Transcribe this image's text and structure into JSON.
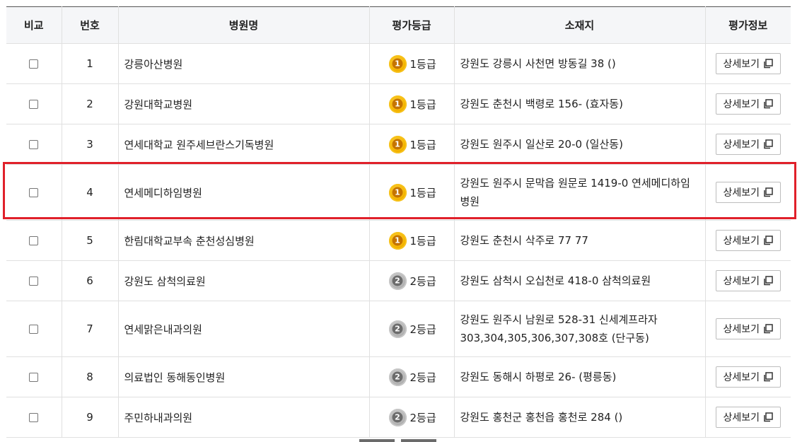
{
  "columns": {
    "compare": "비교",
    "number": "번호",
    "hospital": "병원명",
    "grade": "평가등급",
    "address": "소재지",
    "info": "평가정보"
  },
  "detail_label": "상세보기",
  "rows": [
    {
      "no": "1",
      "name": "강릉아산병원",
      "grade_num": "1",
      "grade": "1등급",
      "address": "강원도 강릉시 사천면 방동길 38 ()"
    },
    {
      "no": "2",
      "name": "강원대학교병원",
      "grade_num": "1",
      "grade": "1등급",
      "address": "강원도 춘천시 백령로 156- (효자동)"
    },
    {
      "no": "3",
      "name": "연세대학교 원주세브란스기독병원",
      "grade_num": "1",
      "grade": "1등급",
      "address": "강원도 원주시 일산로 20-0 (일산동)"
    },
    {
      "no": "4",
      "name": "연세메디하임병원",
      "grade_num": "1",
      "grade": "1등급",
      "address": "강원도 원주시 문막읍 원문로 1419-0 연세메디하임병원"
    },
    {
      "no": "5",
      "name": "한림대학교부속 춘천성심병원",
      "grade_num": "1",
      "grade": "1등급",
      "address": "강원도 춘천시 삭주로 77 77"
    },
    {
      "no": "6",
      "name": "강원도 삼척의료원",
      "grade_num": "2",
      "grade": "2등급",
      "address": "강원도 삼척시 오십천로 418-0 삼척의료원"
    },
    {
      "no": "7",
      "name": "연세맑은내과의원",
      "grade_num": "2",
      "grade": "2등급",
      "address": "강원도 원주시 남원로 528-31 신세계프라자 303,304,305,306,307,308호 (단구동)"
    },
    {
      "no": "8",
      "name": "의료법인 동해동인병원",
      "grade_num": "2",
      "grade": "2등급",
      "address": "강원도 동해시 하평로 26- (평릉동)"
    },
    {
      "no": "9",
      "name": "주민하내과의원",
      "grade_num": "2",
      "grade": "2등급",
      "address": "강원도 홍천군 홍천읍 홍천로 284 ()"
    }
  ],
  "colors": {
    "highlight": "#e0202a",
    "gold_badge": "#f4b400",
    "silver_badge": "#b4b4b4",
    "header_bg": "#f5f6f8"
  }
}
